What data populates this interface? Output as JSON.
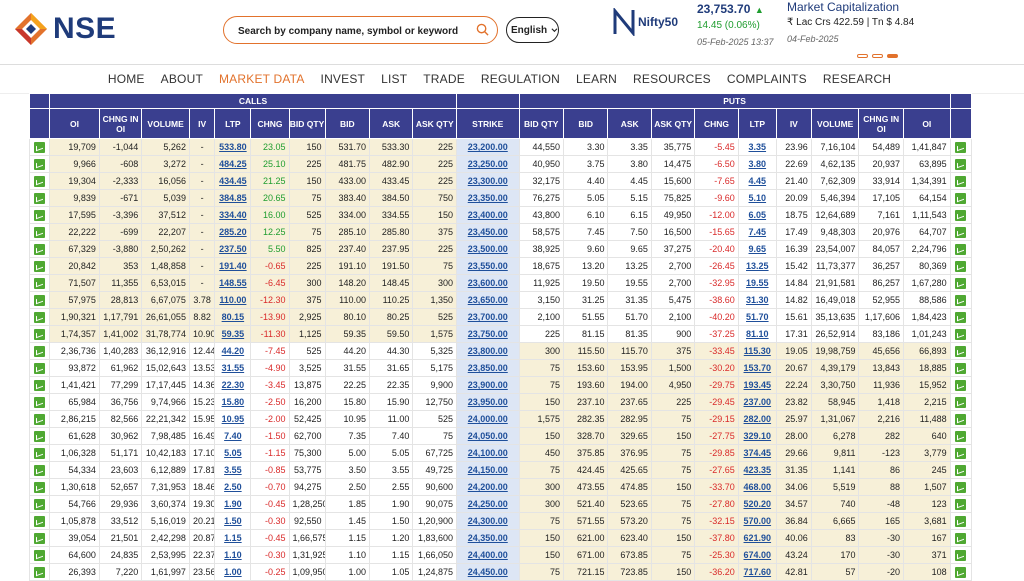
{
  "header": {
    "logo_text": "NSE",
    "search_placeholder": "Search by company name, symbol or keyword",
    "language": "English",
    "index_name": "Nifty50",
    "index_value": "23,753.70",
    "index_change": "14.45 (0.06%)",
    "index_date": "05-Feb-2025 13:37",
    "mcap_title": "Market Capitalization",
    "mcap_value": "₹ Lac Crs 422.59 | Tn $ 4.84",
    "mcap_date": "04-Feb-2025"
  },
  "colors": {
    "brand_orange": "#e2722c",
    "brand_navy": "#1f3b7a",
    "header_bg": "#3a3f8f",
    "pos": "#1f9d2f",
    "neg": "#d92a2a"
  },
  "nav": [
    "HOME",
    "ABOUT",
    "MARKET DATA",
    "INVEST",
    "LIST",
    "TRADE",
    "REGULATION",
    "LEARN",
    "RESOURCES",
    "COMPLAINTS",
    "RESEARCH"
  ],
  "nav_active": 2,
  "table": {
    "calls_label": "CALLS",
    "puts_label": "PUTS",
    "columns": [
      "OI",
      "CHNG IN OI",
      "VOLUME",
      "IV",
      "LTP",
      "CHNG",
      "BID QTY",
      "BID",
      "ASK",
      "ASK QTY",
      "STRIKE",
      "BID QTY",
      "BID",
      "ASK",
      "ASK QTY",
      "CHNG",
      "LTP",
      "IV",
      "VOLUME",
      "CHNG IN OI",
      "OI"
    ],
    "rows": [
      [
        "19,709",
        "-1,044",
        "5,262",
        "-",
        "533.80",
        "23.05",
        "150",
        "531.70",
        "533.30",
        "225",
        "23,200.00",
        "44,550",
        "3.30",
        "3.35",
        "35,775",
        "-5.45",
        "3.35",
        "23.96",
        "7,16,104",
        "54,489",
        "1,41,847"
      ],
      [
        "9,966",
        "-608",
        "3,272",
        "-",
        "484.25",
        "25.10",
        "225",
        "481.75",
        "482.90",
        "225",
        "23,250.00",
        "40,950",
        "3.75",
        "3.80",
        "14,475",
        "-6.50",
        "3.80",
        "22.69",
        "4,62,135",
        "20,937",
        "63,895"
      ],
      [
        "19,304",
        "-2,333",
        "16,056",
        "-",
        "434.45",
        "21.25",
        "150",
        "433.00",
        "433.45",
        "225",
        "23,300.00",
        "32,175",
        "4.40",
        "4.45",
        "15,600",
        "-7.65",
        "4.45",
        "21.40",
        "7,62,309",
        "33,914",
        "1,34,391"
      ],
      [
        "9,839",
        "-671",
        "5,039",
        "-",
        "384.85",
        "20.65",
        "75",
        "383.40",
        "384.50",
        "750",
        "23,350.00",
        "76,275",
        "5.05",
        "5.15",
        "75,825",
        "-9.60",
        "5.10",
        "20.09",
        "5,46,394",
        "17,105",
        "64,154"
      ],
      [
        "17,595",
        "-3,396",
        "37,512",
        "-",
        "334.40",
        "16.00",
        "525",
        "334.00",
        "334.55",
        "150",
        "23,400.00",
        "43,800",
        "6.10",
        "6.15",
        "49,950",
        "-12.00",
        "6.05",
        "18.75",
        "12,64,689",
        "7,161",
        "1,11,543"
      ],
      [
        "22,222",
        "-699",
        "22,207",
        "-",
        "285.20",
        "12.25",
        "75",
        "285.10",
        "285.80",
        "375",
        "23,450.00",
        "58,575",
        "7.45",
        "7.50",
        "16,500",
        "-15.65",
        "7.45",
        "17.49",
        "9,48,303",
        "20,976",
        "64,707"
      ],
      [
        "67,329",
        "-3,880",
        "2,50,262",
        "-",
        "237.50",
        "5.50",
        "825",
        "237.40",
        "237.95",
        "225",
        "23,500.00",
        "38,925",
        "9.60",
        "9.65",
        "37,275",
        "-20.40",
        "9.65",
        "16.39",
        "23,54,007",
        "84,057",
        "2,24,796"
      ],
      [
        "20,842",
        "353",
        "1,48,858",
        "-",
        "191.40",
        "-0.65",
        "225",
        "191.10",
        "191.50",
        "75",
        "23,550.00",
        "18,675",
        "13.20",
        "13.25",
        "2,700",
        "-26.45",
        "13.25",
        "15.42",
        "11,73,377",
        "36,257",
        "80,369"
      ],
      [
        "71,507",
        "11,355",
        "6,53,015",
        "-",
        "148.55",
        "-6.45",
        "300",
        "148.20",
        "148.45",
        "300",
        "23,600.00",
        "11,925",
        "19.50",
        "19.55",
        "2,700",
        "-32.95",
        "19.55",
        "14.84",
        "21,91,581",
        "86,257",
        "1,67,280"
      ],
      [
        "57,975",
        "28,813",
        "6,67,075",
        "3.78",
        "110.00",
        "-12.30",
        "375",
        "110.00",
        "110.25",
        "1,350",
        "23,650.00",
        "3,150",
        "31.25",
        "31.35",
        "5,475",
        "-38.60",
        "31.30",
        "14.82",
        "16,49,018",
        "52,955",
        "88,586"
      ],
      [
        "1,90,321",
        "1,17,791",
        "26,61,055",
        "8.82",
        "80.15",
        "-13.90",
        "2,925",
        "80.10",
        "80.25",
        "525",
        "23,700.00",
        "2,100",
        "51.55",
        "51.70",
        "2,100",
        "-40.20",
        "51.70",
        "15.61",
        "35,13,635",
        "1,17,606",
        "1,84,423"
      ],
      [
        "1,74,357",
        "1,41,002",
        "31,78,774",
        "10.90",
        "59.35",
        "-11.30",
        "1,125",
        "59.35",
        "59.50",
        "1,575",
        "23,750.00",
        "225",
        "81.15",
        "81.35",
        "900",
        "-37.25",
        "81.10",
        "17.31",
        "26,52,914",
        "83,186",
        "1,01,243"
      ],
      [
        "2,36,736",
        "1,40,283",
        "36,12,916",
        "12.44",
        "44.20",
        "-7.45",
        "525",
        "44.20",
        "44.30",
        "5,325",
        "23,800.00",
        "300",
        "115.50",
        "115.70",
        "375",
        "-33.45",
        "115.30",
        "19.05",
        "19,98,759",
        "45,656",
        "66,893"
      ],
      [
        "93,872",
        "61,962",
        "15,02,643",
        "13.53",
        "31.55",
        "-4.90",
        "3,525",
        "31.55",
        "31.65",
        "5,175",
        "23,850.00",
        "75",
        "153.60",
        "153.95",
        "1,500",
        "-30.20",
        "153.70",
        "20.67",
        "4,39,179",
        "13,843",
        "18,885"
      ],
      [
        "1,41,421",
        "77,299",
        "17,17,445",
        "14.36",
        "22.30",
        "-3.45",
        "13,875",
        "22.25",
        "22.35",
        "9,900",
        "23,900.00",
        "75",
        "193.60",
        "194.00",
        "4,950",
        "-29.75",
        "193.45",
        "22.24",
        "3,30,750",
        "11,936",
        "15,952"
      ],
      [
        "65,984",
        "36,756",
        "9,74,966",
        "15.23",
        "15.80",
        "-2.50",
        "16,200",
        "15.80",
        "15.90",
        "12,750",
        "23,950.00",
        "150",
        "237.10",
        "237.65",
        "225",
        "-29.45",
        "237.00",
        "23.82",
        "58,945",
        "1,418",
        "2,215"
      ],
      [
        "2,86,215",
        "82,566",
        "22,21,342",
        "15.95",
        "10.95",
        "-2.00",
        "52,425",
        "10.95",
        "11.00",
        "525",
        "24,000.00",
        "1,575",
        "282.35",
        "282.95",
        "75",
        "-29.15",
        "282.00",
        "25.97",
        "1,31,067",
        "2,216",
        "11,488"
      ],
      [
        "61,628",
        "30,962",
        "7,98,485",
        "16.49",
        "7.40",
        "-1.50",
        "62,700",
        "7.35",
        "7.40",
        "75",
        "24,050.00",
        "150",
        "328.70",
        "329.65",
        "150",
        "-27.75",
        "329.10",
        "28.00",
        "6,278",
        "282",
        "640"
      ],
      [
        "1,06,328",
        "51,171",
        "10,42,183",
        "17.10",
        "5.05",
        "-1.15",
        "75,300",
        "5.00",
        "5.05",
        "67,725",
        "24,100.00",
        "450",
        "375.85",
        "376.95",
        "75",
        "-29.85",
        "374.45",
        "29.66",
        "9,811",
        "-123",
        "3,779"
      ],
      [
        "54,334",
        "23,603",
        "6,12,889",
        "17.81",
        "3.55",
        "-0.85",
        "53,775",
        "3.50",
        "3.55",
        "49,725",
        "24,150.00",
        "75",
        "424.45",
        "425.65",
        "75",
        "-27.65",
        "423.35",
        "31.35",
        "1,141",
        "86",
        "245"
      ],
      [
        "1,30,618",
        "52,657",
        "7,31,953",
        "18.46",
        "2.50",
        "-0.70",
        "94,275",
        "2.50",
        "2.55",
        "90,600",
        "24,200.00",
        "300",
        "473.55",
        "474.85",
        "150",
        "-33.70",
        "468.00",
        "34.06",
        "5,519",
        "88",
        "1,507"
      ],
      [
        "54,766",
        "29,936",
        "3,60,374",
        "19.30",
        "1.90",
        "-0.45",
        "1,28,250",
        "1.85",
        "1.90",
        "90,075",
        "24,250.00",
        "300",
        "521.40",
        "523.65",
        "75",
        "-27.80",
        "520.20",
        "34.57",
        "740",
        "-48",
        "123"
      ],
      [
        "1,05,878",
        "33,512",
        "5,16,019",
        "20.21",
        "1.50",
        "-0.30",
        "92,550",
        "1.45",
        "1.50",
        "1,20,900",
        "24,300.00",
        "75",
        "571.55",
        "573.20",
        "75",
        "-32.15",
        "570.00",
        "36.84",
        "6,665",
        "165",
        "3,681"
      ],
      [
        "39,054",
        "21,501",
        "2,42,298",
        "20.87",
        "1.15",
        "-0.45",
        "1,66,575",
        "1.15",
        "1.20",
        "1,83,600",
        "24,350.00",
        "150",
        "621.00",
        "623.40",
        "150",
        "-37.80",
        "621.90",
        "40.06",
        "83",
        "-30",
        "167"
      ],
      [
        "64,600",
        "24,835",
        "2,53,995",
        "22.37",
        "1.10",
        "-0.30",
        "1,31,925",
        "1.10",
        "1.15",
        "1,66,050",
        "24,400.00",
        "150",
        "671.00",
        "673.85",
        "75",
        "-25.30",
        "674.00",
        "43.24",
        "170",
        "-30",
        "371"
      ],
      [
        "26,393",
        "7,220",
        "1,61,997",
        "23.56",
        "1.00",
        "-0.25",
        "1,09,950",
        "1.00",
        "1.05",
        "1,24,875",
        "24,450.00",
        "75",
        "721.15",
        "723.85",
        "150",
        "-36.20",
        "717.60",
        "42.81",
        "57",
        "-20",
        "108"
      ]
    ]
  }
}
